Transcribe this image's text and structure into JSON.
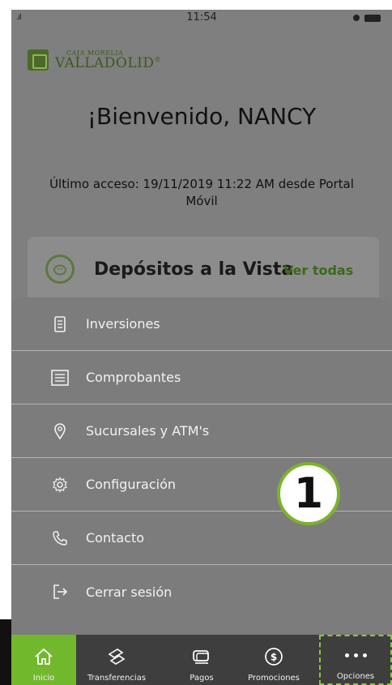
{
  "status_bar": {
    "time": "11:54",
    "signal": ".ıl"
  },
  "logo": {
    "top": "CAJA MORELIA",
    "main": "VALLADOLID",
    "reg": "®"
  },
  "welcome": "¡Bienvenido, NANCY",
  "last_access": "Último acceso: 19/11/2019 11:22 AM desde Portal Móvil",
  "deposit_card": {
    "title": "Depósitos a la Vista",
    "link": "Ver todas"
  },
  "menu": {
    "items": [
      {
        "label": "Inversiones",
        "icon": "document-icon"
      },
      {
        "label": "Comprobantes",
        "icon": "receipt-list-icon"
      },
      {
        "label": "Sucursales y ATM's",
        "icon": "location-pin-icon"
      },
      {
        "label": "Configuración",
        "icon": "gear-icon"
      },
      {
        "label": "Contacto",
        "icon": "phone-icon"
      },
      {
        "label": "Cerrar sesión",
        "icon": "logout-icon"
      }
    ]
  },
  "step_badge": "1",
  "tabs": [
    {
      "label": "Inicio",
      "icon": "home-icon",
      "active": true
    },
    {
      "label": "Transferencias",
      "icon": "transfer-icon",
      "active": false
    },
    {
      "label": "Pagos",
      "icon": "payment-card-icon",
      "active": false
    },
    {
      "label": "Promociones",
      "icon": "dollar-coin-icon",
      "active": false
    },
    {
      "label": "Opciones",
      "icon": "more-dots-icon",
      "active": false
    }
  ],
  "colors": {
    "accent": "#72b82c",
    "overlay": "#7f7f7f",
    "tabbar": "#3e3e3e"
  }
}
